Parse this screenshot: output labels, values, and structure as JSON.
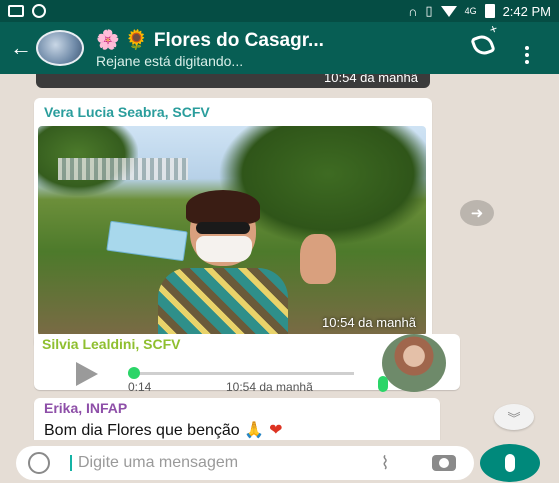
{
  "status_bar": {
    "time": "2:42 PM",
    "network": "4G"
  },
  "header": {
    "title": "🌸 🌻 Flores do Casagr...",
    "subtitle": "Rejane está digitando..."
  },
  "messages": [
    {
      "type": "image_tail",
      "time": "10:54 da manhã"
    },
    {
      "type": "image",
      "sender": "Vera Lucia Seabra, SCFV",
      "time": "10:54 da manhã"
    },
    {
      "type": "audio",
      "sender": "Silvia Lealdini, SCFV",
      "duration": "0:14",
      "time": "10:54 da manhã"
    },
    {
      "type": "text",
      "sender": "Erika, INFAP",
      "text": "Bom dia Flores  que benção",
      "emoji": "🙏 ❤"
    }
  ],
  "input": {
    "placeholder": "Digite uma mensagem"
  },
  "colors": {
    "header": "#075e54",
    "status_bar": "#054d44",
    "accent": "#00897b",
    "chat_bg": "#e5ddd5"
  }
}
